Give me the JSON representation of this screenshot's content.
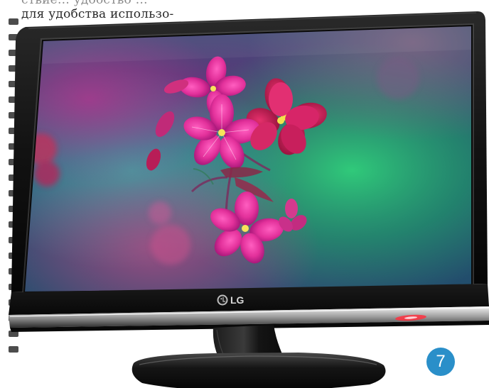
{
  "article": {
    "top_line_partial": "ствие…  удобство …",
    "top_line": "для удобства использо-"
  },
  "monitor": {
    "brand": "LG",
    "bezel_color": "#141414",
    "screen_accent": "#d8307a",
    "power_led_color": "#e0202a"
  },
  "page": {
    "number": "7",
    "badge_color": "#2a8fc9"
  }
}
